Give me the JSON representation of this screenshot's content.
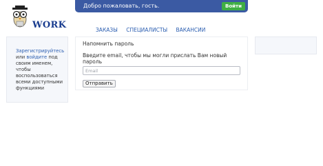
{
  "logo": {
    "text": "WORK",
    "mascot_icon": "owl-with-glasses-icon"
  },
  "header": {
    "welcome": "Добро пожаловать, гость.",
    "login_label": "Войти"
  },
  "nav": {
    "items": [
      "ЗАКАЗЫ",
      "СПЕЦИАЛИСТЫ",
      "ВАКАНСИИ"
    ]
  },
  "sidebar": {
    "register_link": "Зарегистрируйтесь",
    "or_text": "или",
    "login_link": "войдите",
    "rest_text": "под своим именем, чтобы воспользоваться всеми доступными функциями"
  },
  "form": {
    "title": "Напомнить пароль",
    "description": "Введите email, чтобы мы могли прислать Вам новый пароль",
    "email_placeholder": "Email",
    "email_value": "",
    "submit_label": "Отправить"
  },
  "colors": {
    "header_bg": "#3b5aa3",
    "login_bg": "#3fae43",
    "link": "#2a5db0",
    "logo_text": "#1a3d8f"
  }
}
